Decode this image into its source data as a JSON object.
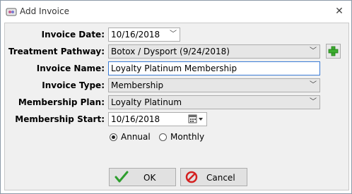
{
  "window": {
    "title": "Add Invoice",
    "close_glyph": "✕"
  },
  "form": {
    "invoice_date": {
      "label": "Invoice Date:",
      "value": "10/16/2018"
    },
    "treatment_pathway": {
      "label": "Treatment Pathway:",
      "value": "Botox / Dysport (9/24/2018)"
    },
    "invoice_name": {
      "label": "Invoice Name:",
      "value": "Loyalty Platinum Membership"
    },
    "invoice_type": {
      "label": "Invoice Type:",
      "value": "Membership"
    },
    "membership_plan": {
      "label": "Membership Plan:",
      "value": "Loyalty Platinum"
    },
    "membership_start": {
      "label": "Membership Start:",
      "value": "10/16/2018"
    },
    "billing": {
      "annual_label": "Annual",
      "monthly_label": "Monthly",
      "selected": "Annual"
    }
  },
  "buttons": {
    "ok_label": "OK",
    "cancel_label": "Cancel"
  },
  "colors": {
    "plus_green": "#3cae2f",
    "check_green": "#2e9e2e",
    "cancel_red": "#d42020"
  }
}
